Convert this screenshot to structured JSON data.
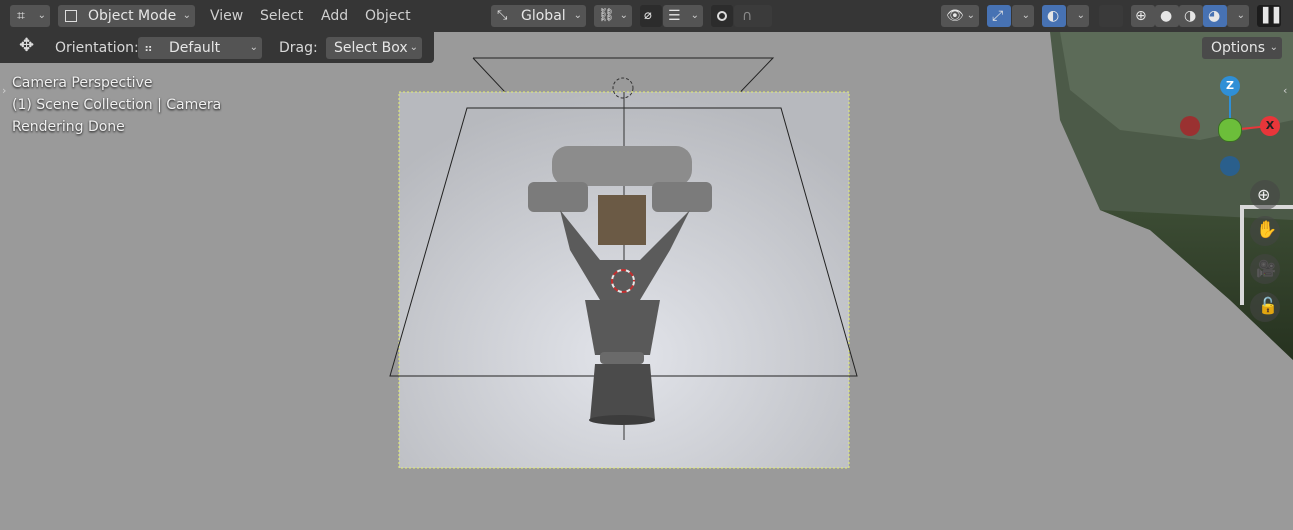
{
  "header": {
    "mode_label": "Object Mode",
    "menus": [
      "View",
      "Select",
      "Add",
      "Object"
    ],
    "orientation_global": "Global"
  },
  "tool_settings": {
    "orientation_label": "Orientation:",
    "orientation_value": "Default",
    "drag_label": "Drag:",
    "drag_value": "Select Box",
    "options_label": "Options"
  },
  "overlay_text": {
    "line1": "Camera Perspective",
    "line2": "(1) Scene Collection | Camera",
    "line3": "Rendering Done"
  },
  "gizmo": {
    "z_label": "Z",
    "x_label": "X"
  },
  "icons": {
    "editor_type": "editor-type-icon",
    "transform": "transform-icon",
    "orientation_pivot": "orientation-icon",
    "snap": "snap-icon",
    "proportional": "proportional-edit-icon",
    "visibility": "visibility-icon",
    "gizmo_toggle": "gizmo-icon",
    "overlays": "overlays-icon",
    "xray": "xray-icon",
    "shading": [
      "wireframe-icon",
      "solid-icon",
      "material-icon",
      "rendered-icon"
    ],
    "pause": "pause-icon",
    "zoom": "zoom-icon",
    "pan": "hand-icon",
    "camera_view": "camera-icon",
    "lock": "lock-icon"
  },
  "colors": {
    "axis_x": "#e8363a",
    "axis_y": "#6cbe3a",
    "axis_z": "#2f8fd6",
    "active_blue": "#4772b3"
  }
}
